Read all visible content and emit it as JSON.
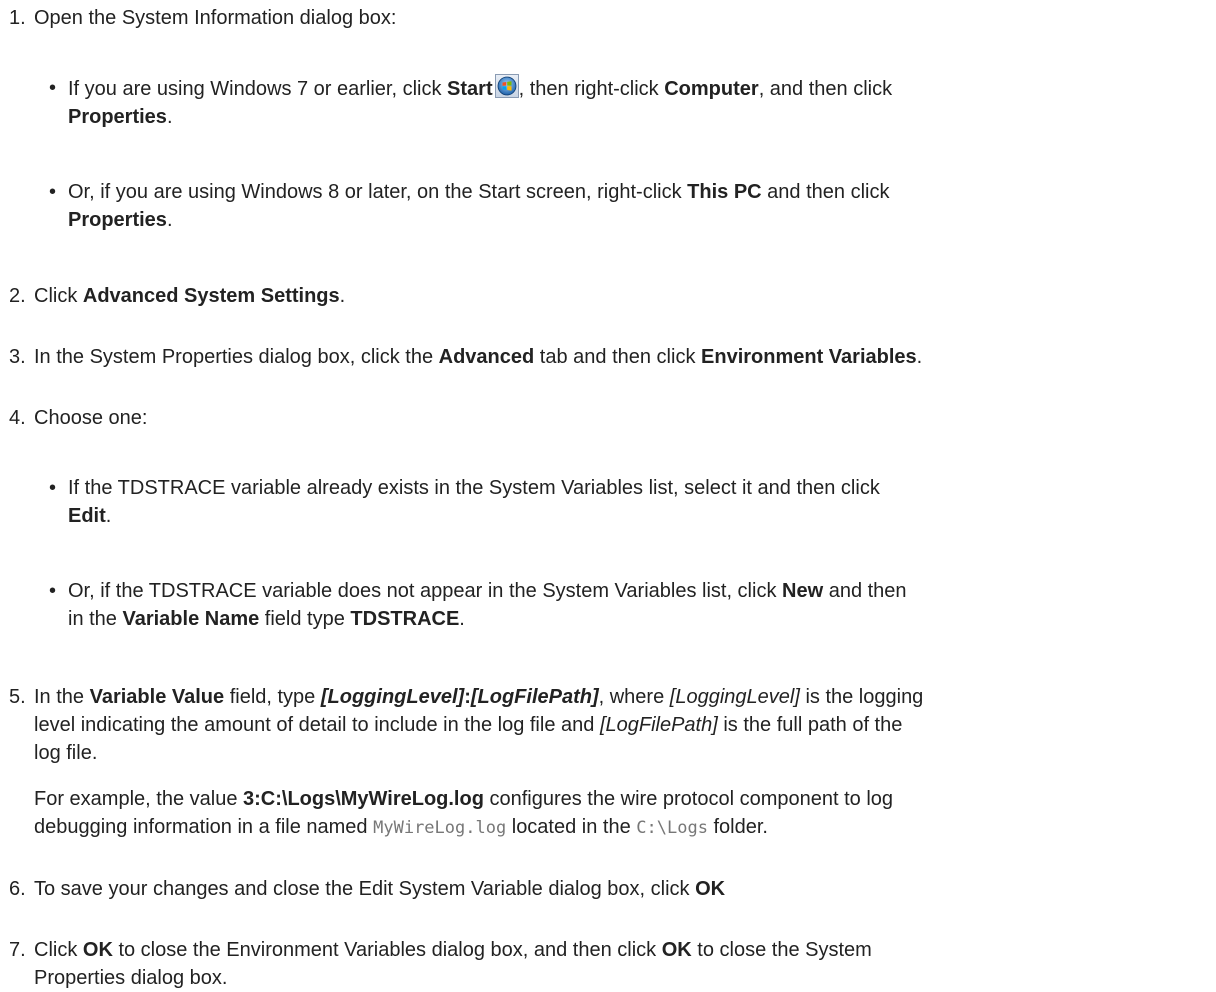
{
  "steps": [
    {
      "num": "1.",
      "text": "Open the System Information dialog box:",
      "bullets": [
        {
          "marker": "•",
          "t1": "If you are using Windows 7 or earlier, click ",
          "b1": "Start",
          "icon": "windows-start-orb-icon",
          "t2": ", then right-click ",
          "b2": "Computer",
          "t3": ", and then click",
          "b3": "Properties",
          "t4": "."
        },
        {
          "marker": "•",
          "t1": "Or, if you are using Windows 8 or later, on the Start screen, right-click ",
          "b1": "This PC",
          "t2": " and then click",
          "b2": "Properties",
          "t3": "."
        }
      ]
    },
    {
      "num": "2.",
      "t1": "Click ",
      "b1": "Advanced System Settings",
      "t2": "."
    },
    {
      "num": "3.",
      "t1": "In the System Properties dialog box, click the ",
      "b1": "Advanced",
      "t2": " tab and then click ",
      "b2": "Environment Variables",
      "t3": "."
    },
    {
      "num": "4.",
      "text": "Choose one:",
      "bullets": [
        {
          "marker": "•",
          "t1": "If the TDSTRACE variable already exists in the System Variables list, select it and then click",
          "b1": "Edit",
          "t2": "."
        },
        {
          "marker": "•",
          "t1": "Or, if the TDSTRACE variable does not appear in the System Variables list, click ",
          "b1": "New",
          "t2": " and then",
          "t3": "in the ",
          "b2": "Variable Name",
          "t4": " field type ",
          "b3": "TDSTRACE",
          "t5": "."
        }
      ]
    },
    {
      "num": "5.",
      "t1": "In the ",
      "b1": "Variable Value",
      "t2": " field, type ",
      "bi1": "[LoggingLevel]",
      "b2": ":",
      "bi2": "[LogFilePath]",
      "t3": ", where ",
      "i1": "[LoggingLevel]",
      "t4": " is the logging",
      "t5": "level indicating the amount of detail to include in the log file and ",
      "i2": "[LogFilePath]",
      "t6": " is the full path of the",
      "t7": "log file.",
      "example": {
        "t1": "For example, the value ",
        "b1": "3:C:\\Logs\\MyWireLog.log",
        "t2": " configures the wire protocol component to log",
        "t3": "debugging information in a file named ",
        "code1": "MyWireLog.log",
        "t4": " located in the ",
        "code2": "C:\\Logs",
        "t5": " folder."
      }
    },
    {
      "num": "6.",
      "t1": "To save your changes and close the Edit System Variable dialog box, click ",
      "b1": "OK"
    },
    {
      "num": "7.",
      "t1": "Click ",
      "b1": "OK",
      "t2": " to close the Environment Variables dialog box, and then click ",
      "b2": "OK",
      "t3": " to close the System",
      "t4": "Properties dialog box."
    }
  ]
}
